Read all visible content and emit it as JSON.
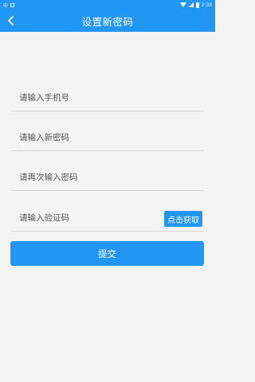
{
  "status_bar": {
    "left_label": "中",
    "time": "2:33"
  },
  "app_bar": {
    "title": "设置新密码",
    "back_icon": "chevron-left-icon"
  },
  "form": {
    "phone_placeholder": "请输入手机号",
    "new_password_placeholder": "请输入新密码",
    "confirm_password_placeholder": "请再次输入密码",
    "code_placeholder": "请输入验证码",
    "get_code_label": "点击获取",
    "submit_label": "提交"
  },
  "colors": {
    "accent": "#2196f3",
    "background": "#f3f3f3",
    "divider": "#d6d6d6"
  }
}
